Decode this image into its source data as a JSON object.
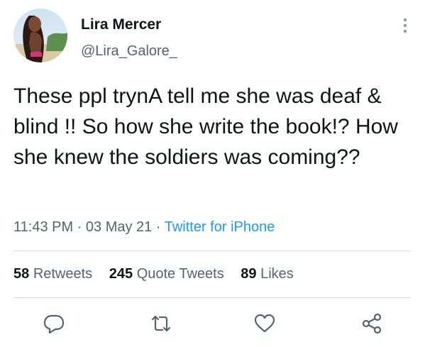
{
  "user": {
    "name": "Lira Mercer",
    "handle": "@Lira_Galore_"
  },
  "tweet": {
    "text": "These ppl trynA tell me she was deaf & blind !! So how she write the book!? How she knew the soldiers was coming??",
    "time": "11:43 PM",
    "separator1": " · ",
    "date": "03 May 21",
    "separator2": " · ",
    "source": "Twitter for iPhone"
  },
  "stats": {
    "retweets_count": "58",
    "retweets_label": "Retweets",
    "quotes_count": "245",
    "quotes_label": "Quote Tweets",
    "likes_count": "89",
    "likes_label": "Likes"
  },
  "icons": {
    "more": "more-vertical-icon",
    "reply": "reply-icon",
    "retweet": "retweet-icon",
    "like": "like-icon",
    "share": "share-icon"
  },
  "colors": {
    "text": "#0f1419",
    "secondary": "#536471",
    "accent": "#1d9bf0",
    "divider": "#cfd9de"
  }
}
